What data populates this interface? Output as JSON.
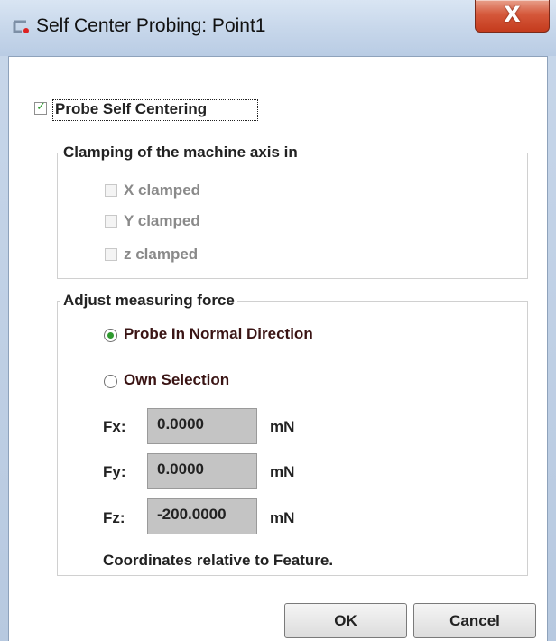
{
  "window": {
    "title": "Self Center Probing: Point1",
    "close_label": "X"
  },
  "main": {
    "probe_self_centering": {
      "label": "Probe Self Centering",
      "checked": true
    }
  },
  "clamping_group": {
    "title": "Clamping of the machine axis in",
    "items": [
      {
        "label": "X clamped",
        "checked": false,
        "enabled": false
      },
      {
        "label": "Y clamped",
        "checked": false,
        "enabled": false
      },
      {
        "label": "z clamped",
        "checked": false,
        "enabled": false
      }
    ]
  },
  "force_group": {
    "title": "Adjust measuring force",
    "options": [
      {
        "label": "Probe In Normal Direction",
        "selected": true
      },
      {
        "label": "Own Selection",
        "selected": false
      }
    ],
    "fields": [
      {
        "label": "Fx:",
        "value": "0.0000",
        "unit": "mN"
      },
      {
        "label": "Fy:",
        "value": "0.0000",
        "unit": "mN"
      },
      {
        "label": "Fz:",
        "value": "-200.0000",
        "unit": "mN"
      }
    ],
    "note": "Coordinates relative to Feature."
  },
  "buttons": {
    "ok": "OK",
    "cancel": "Cancel"
  },
  "colors": {
    "checkmark": "#2a9a2a",
    "radio_dot": "#2f9a2f",
    "close_button": "#c43b1d"
  }
}
